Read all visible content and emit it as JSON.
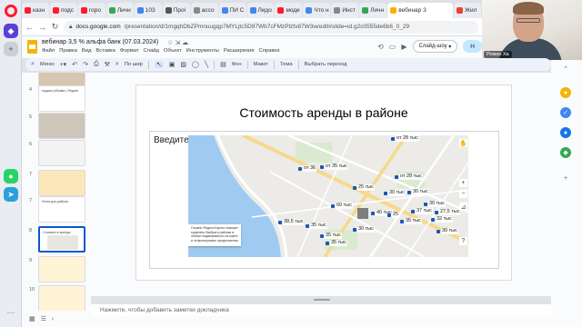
{
  "browser": {
    "tabs": [
      {
        "label": "казн",
        "color": "#ff1b2d",
        "active": false
      },
      {
        "label": "подс",
        "color": "#ff1b2d",
        "active": false
      },
      {
        "label": "горо",
        "color": "#ff1b2d",
        "active": false
      },
      {
        "label": "Личн",
        "color": "#34a853",
        "active": false
      },
      {
        "label": "103",
        "color": "#4285f4",
        "active": false
      },
      {
        "label": "Проі",
        "color": "#555555",
        "active": false
      },
      {
        "label": "ассо",
        "color": "#888888",
        "active": false
      },
      {
        "label": "ПИ С",
        "color": "#4285f4",
        "active": false
      },
      {
        "label": "Лидо",
        "color": "#4285f4",
        "active": false
      },
      {
        "label": "моде",
        "color": "#ff1b2d",
        "active": false
      },
      {
        "label": "Что н",
        "color": "#4285f4",
        "active": false
      },
      {
        "label": "Инст",
        "color": "#888888",
        "active": false
      },
      {
        "label": "Личн",
        "color": "#34a853",
        "active": false
      },
      {
        "label": "вебинар 3",
        "color": "#f4b400",
        "active": true
      },
      {
        "label": "Жил",
        "color": "#ea4335",
        "active": false
      }
    ],
    "url": {
      "domain": "docs.google.com",
      "path": "/presentation/d/1mgqhDbZPmnuugqp7MYLjtc5D97Wb7cFMzPlzfx87W3w/edit#slide=id.g2c0555de6b6_0_29"
    }
  },
  "webcam": {
    "name_label": "Роман Ха"
  },
  "slides_app": {
    "doc_title": "вебинар 3,5 % альфа банк (07.03.2024)",
    "menus": [
      "Файл",
      "Правка",
      "Вид",
      "Вставка",
      "Формат",
      "Слайд",
      "Объект",
      "Инструменты",
      "Расширения",
      "Справка"
    ],
    "slideshow_label": "Слайд-шоу",
    "share_label": "Н",
    "toolbar": {
      "search_label": "Меню",
      "zoom_label": "По шир",
      "background_label": "Фон",
      "layout_label": "Макет",
      "theme_label": "Тема",
      "transition_label": "Выбрать переход"
    }
  },
  "filmstrip": {
    "slides": [
      {
        "number": "",
        "caption": ""
      },
      {
        "number": "4",
        "caption": "подача (объявл.) Яндекс"
      },
      {
        "number": "5",
        "caption": ""
      },
      {
        "number": "6",
        "caption": ""
      },
      {
        "number": "7",
        "caption": ""
      },
      {
        "number": "7",
        "caption": "Итоги для района"
      },
      {
        "number": "8",
        "caption": "Стоимость аренды"
      },
      {
        "number": "9",
        "caption": ""
      },
      {
        "number": "10",
        "caption": ""
      }
    ],
    "selected_index": 6
  },
  "slide": {
    "title": "Стоимость аренды в районе",
    "textbox_text": "Введите",
    "map_popup": "Сервис Яндекс.Карты поможет сравнить Выбрать районы в любых недвижимость на карте и отфильтровать предложения",
    "prices": [
      {
        "text": "от 28 тыс"
      },
      {
        "text": "от 36"
      },
      {
        "text": "от 35 тыс"
      },
      {
        "text": "от 28 тыс"
      },
      {
        "text": "25 тыс"
      },
      {
        "text": "30 тыс"
      },
      {
        "text": "30 тыс"
      },
      {
        "text": "60 тыс"
      },
      {
        "text": "30 тыс"
      },
      {
        "text": "40 тыс"
      },
      {
        "text": "37 тыс"
      },
      {
        "text": "25"
      },
      {
        "text": "27,5 тыс"
      },
      {
        "text": "32 тыс"
      },
      {
        "text": "35 тыс"
      },
      {
        "text": "38,5 тыс"
      },
      {
        "text": "35 тыс"
      },
      {
        "text": "35 тыс"
      },
      {
        "text": "30 тыс"
      },
      {
        "text": "35 тыс"
      },
      {
        "text": "30 тыс"
      }
    ]
  },
  "notes": {
    "placeholder": "Нажмите, чтобы добавить заметки докладчика"
  }
}
